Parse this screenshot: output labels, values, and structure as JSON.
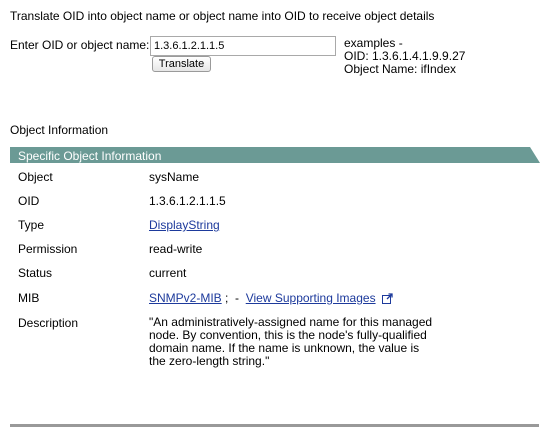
{
  "intro": "Translate OID into object name or object name into OID to receive object details",
  "form": {
    "label": "Enter OID or object name:",
    "value": "1.3.6.1.2.1.1.5",
    "button": "Translate",
    "examples_title": "examples -",
    "examples_oid": "OID: 1.3.6.1.4.1.9.9.27",
    "examples_name": "Object Name: ifIndex"
  },
  "section_title": "Object Information",
  "table": {
    "header": "Specific Object Information",
    "header_color": "#6b9a95",
    "rows": {
      "object": {
        "label": "Object",
        "value": "sysName"
      },
      "oid": {
        "label": "OID",
        "value": "1.3.6.1.2.1.1.5"
      },
      "type": {
        "label": "Type",
        "value": "DisplayString"
      },
      "permission": {
        "label": "Permission",
        "value": "read-write"
      },
      "status": {
        "label": "Status",
        "value": "current"
      },
      "mib": {
        "label": "MIB",
        "value": "SNMPv2-MIB",
        "sep1": ";",
        "sep2": "-",
        "link": "View Supporting Images",
        "link_icon": "external-link-icon"
      },
      "description": {
        "label": "Description",
        "value": "\"An administratively-assigned name for this managed node. By convention, this is the node's fully-qualified domain name. If the name is unknown, the value is the zero-length string.\""
      }
    }
  }
}
